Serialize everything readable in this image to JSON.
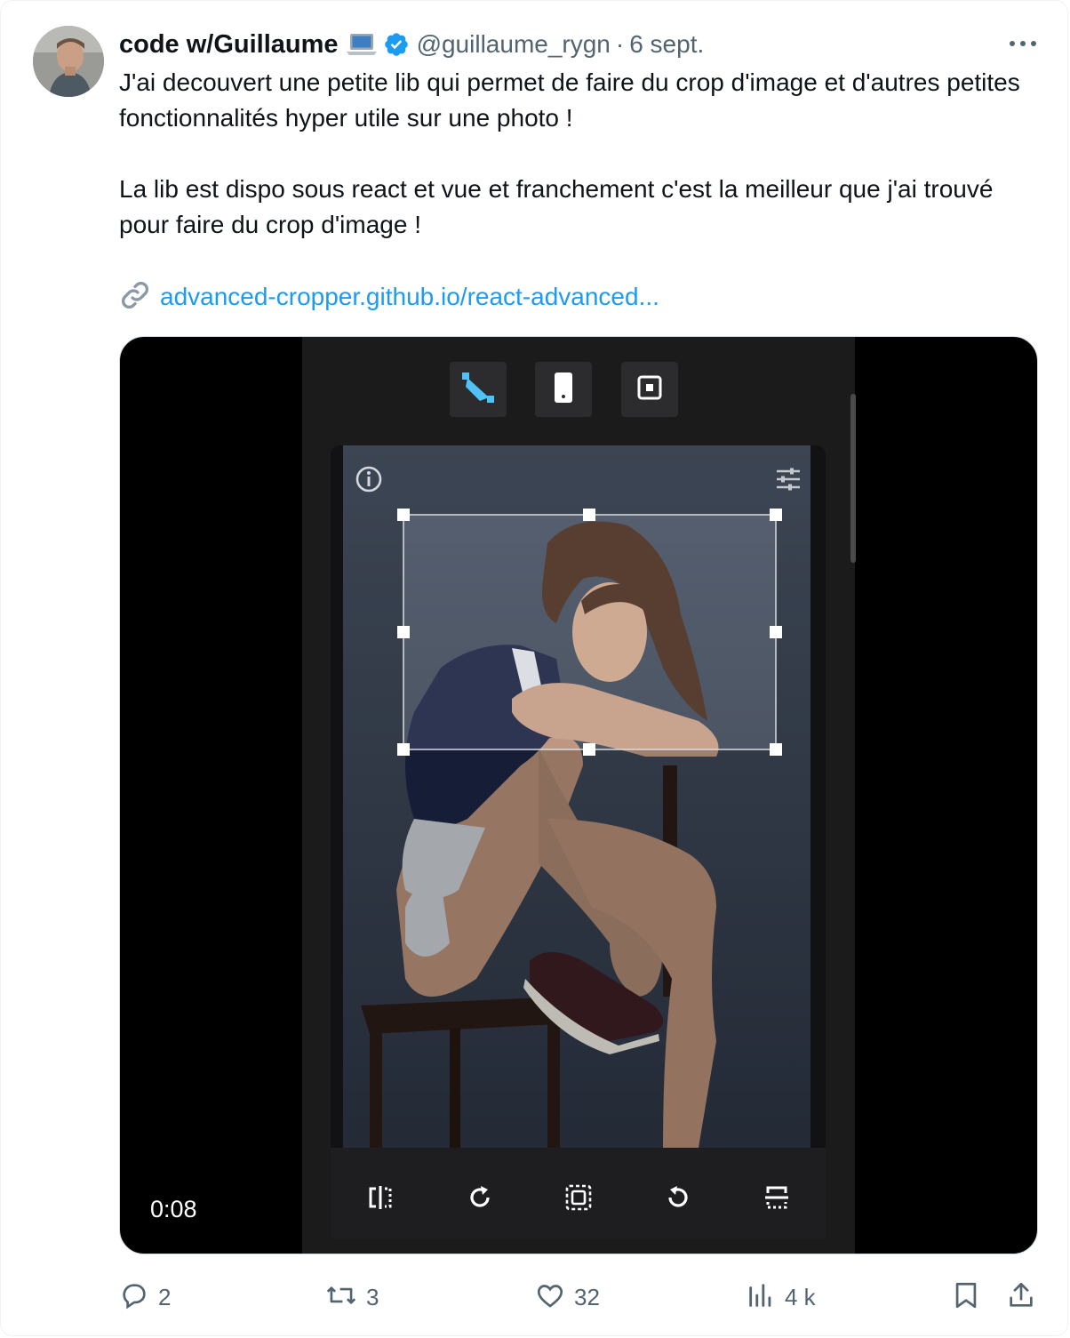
{
  "tweet": {
    "author_name": "code w/Guillaume",
    "handle": "@guillaume_rygn",
    "separator": "·",
    "date": "6 sept.",
    "text_paragraph_1": "J'ai decouvert une petite lib qui permet de faire du crop d'image et d'autres petites fonctionnalités hyper utile sur une photo !",
    "text_paragraph_2": "La lib est dispo sous react et vue et franchement c'est la meilleur que j'ai trouvé pour faire du crop d'image !",
    "link": "advanced-cropper.github.io/react-advanced..."
  },
  "video": {
    "timestamp": "0:08",
    "top_buttons": [
      "crop-mode-icon",
      "phone-ratio-icon",
      "square-ratio-icon"
    ],
    "bottom_tools": [
      "flip-horizontal-icon",
      "rotate-right-icon",
      "fit-icon",
      "rotate-left-icon",
      "flip-vertical-icon"
    ],
    "accent_color": "#4fc3f7"
  },
  "actions": {
    "replies": "2",
    "reposts": "3",
    "likes": "32",
    "views": "4 k"
  },
  "colors": {
    "link": "#1d9bf0",
    "verified": "#1d9bf0",
    "muted": "#536471",
    "text": "#0f1419"
  }
}
